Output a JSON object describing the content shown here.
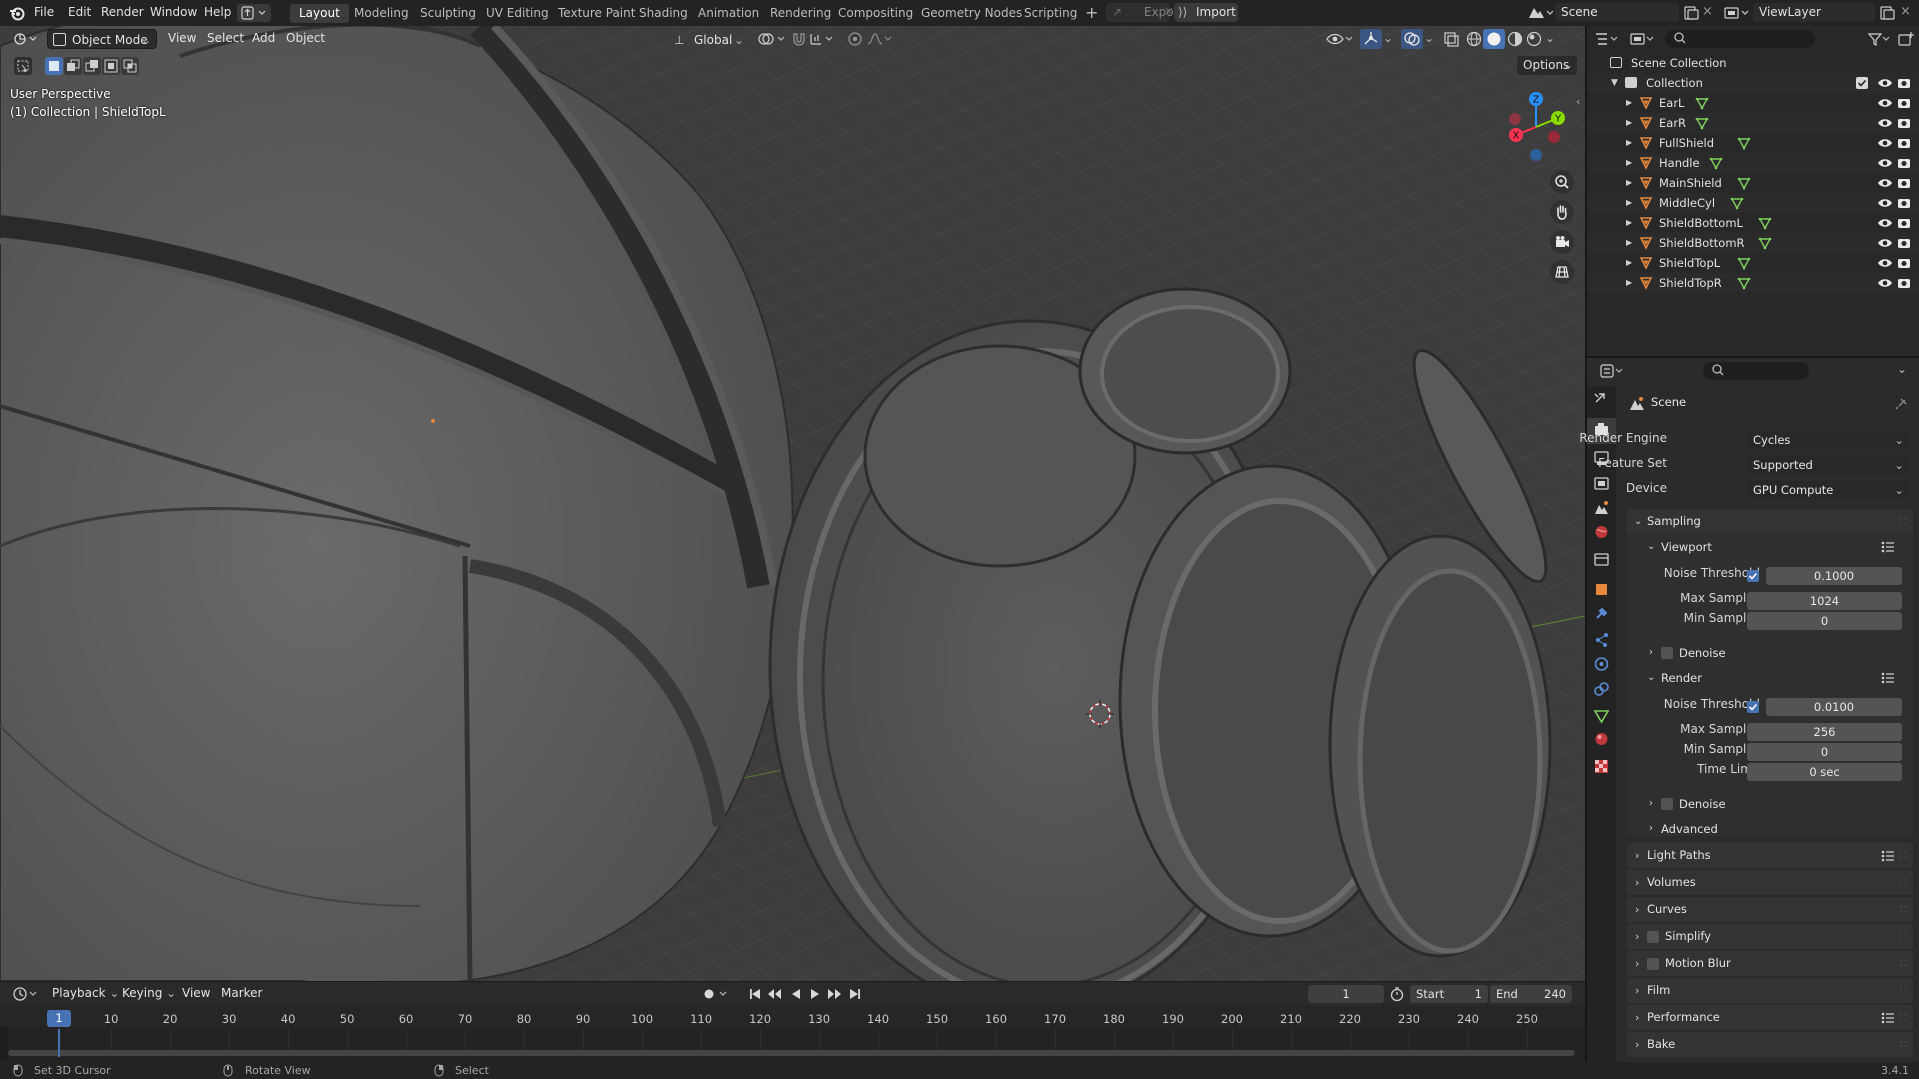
{
  "menus": [
    "File",
    "Edit",
    "Render",
    "Window",
    "Help"
  ],
  "workspaces": [
    "Layout",
    "Modeling",
    "Sculpting",
    "UV Editing",
    "Texture Paint",
    "Shading",
    "Animation",
    "Rendering",
    "Compositing",
    "Geometry Nodes",
    "Scripting"
  ],
  "active_workspace": "Layout",
  "topbar": {
    "export_label": "Export",
    "import_label": "Import",
    "scene_name": "Scene",
    "view_layer": "ViewLayer"
  },
  "viewport": {
    "mode": "Object Mode",
    "menus": [
      "View",
      "Select",
      "Add",
      "Object"
    ],
    "transform_orientation": "Global",
    "options_label": "Options",
    "perspective_label": "User Perspective",
    "collection_label": "(1) Collection | ShieldTopL",
    "gizmo_axes": {
      "x": "X",
      "y": "Y",
      "z": "Z"
    }
  },
  "outliner": {
    "root": "Scene Collection",
    "collection": "Collection",
    "objects": [
      "EarL",
      "EarR",
      "FullShield",
      "Handle",
      "MainShield",
      "MiddleCyl",
      "ShieldBottomL",
      "ShieldBottomR",
      "ShieldTopL",
      "ShieldTopR"
    ]
  },
  "properties": {
    "context_title": "Scene",
    "render_engine_label": "Render Engine",
    "render_engine": "Cycles",
    "feature_set_label": "Feature Set",
    "feature_set": "Supported",
    "device_label": "Device",
    "device": "GPU Compute",
    "sampling_label": "Sampling",
    "viewport_section": {
      "label": "Viewport",
      "noise_threshold_label": "Noise Threshold",
      "noise_threshold": "0.1000",
      "noise_threshold_enabled": true,
      "max_samples_label": "Max Samples",
      "max_samples": "1024",
      "min_samples_label": "Min Samples",
      "min_samples": "0",
      "denoise_label": "Denoise"
    },
    "render_section": {
      "label": "Render",
      "noise_threshold_label": "Noise Threshold",
      "noise_threshold": "0.0100",
      "noise_threshold_enabled": true,
      "max_samples_label": "Max Samples",
      "max_samples": "256",
      "min_samples_label": "Min Samples",
      "min_samples": "0",
      "time_limit_label": "Time Limit",
      "time_limit": "0 sec",
      "denoise_label": "Denoise"
    },
    "advanced_label": "Advanced",
    "panels": [
      "Light Paths",
      "Volumes",
      "Curves",
      "Simplify",
      "Motion Blur",
      "Film",
      "Performance",
      "Bake"
    ]
  },
  "timeline": {
    "menus": [
      "Playback",
      "Keying",
      "View",
      "Marker"
    ],
    "current_frame": "1",
    "start_label": "Start",
    "start": "1",
    "end_label": "End",
    "end": "240",
    "ruler": [
      "1",
      "10",
      "20",
      "30",
      "40",
      "50",
      "60",
      "70",
      "80",
      "90",
      "100",
      "110",
      "120",
      "130",
      "140",
      "150",
      "160",
      "170",
      "180",
      "190",
      "200",
      "210",
      "220",
      "230",
      "240",
      "250"
    ]
  },
  "statusbar": {
    "hint_left": "Set 3D Cursor",
    "hint_middle": "Rotate View",
    "hint_right": "Select",
    "version": "3.4.1"
  },
  "colors": {
    "accent": "#4772b3",
    "object_orange": "#e8883a",
    "mesh_green": "#7fcf5c",
    "axis_x": "#ff3352",
    "axis_y": "#8bdc00",
    "axis_z": "#2890ff"
  },
  "icons": {
    "app": "blender-logo-icon",
    "outliner_object": "object-triangle-icon",
    "outliner_mesh": "mesh-data-icon",
    "visibility": "eye-icon",
    "render_visibility": "camera-icon"
  }
}
